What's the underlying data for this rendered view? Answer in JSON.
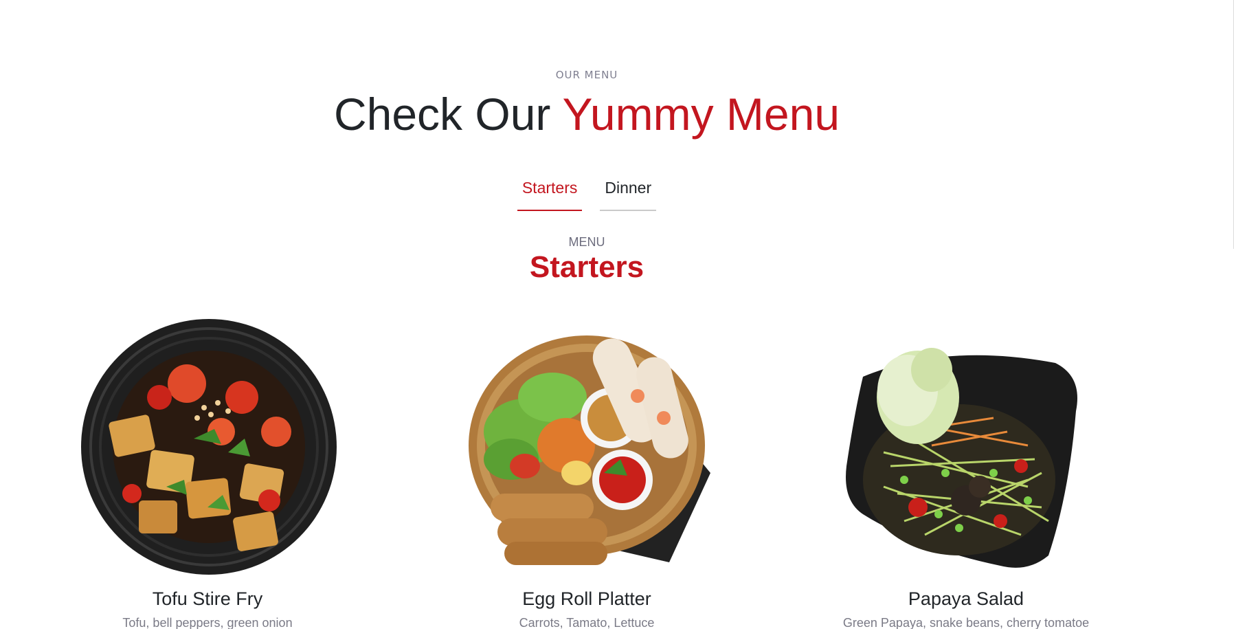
{
  "section": {
    "eyebrow": "OUR MENU",
    "heading_prefix": "Check Our ",
    "heading_accent": "Yummy Menu"
  },
  "tabs": [
    {
      "label": "Starters",
      "active": true
    },
    {
      "label": "Dinner",
      "active": false
    }
  ],
  "menu": {
    "label": "MENU",
    "title": "Starters",
    "items": [
      {
        "name": "Tofu Stire Fry",
        "description": "Tofu, bell peppers, green onion"
      },
      {
        "name": "Egg Roll Platter",
        "description": "Carrots, Tamato, Lettuce"
      },
      {
        "name": "Papaya Salad",
        "description": "Green Papaya, snake beans, cherry tomatoe"
      }
    ]
  },
  "colors": {
    "accent": "#c3161f",
    "text": "#212529",
    "muted": "#7a7a86"
  }
}
